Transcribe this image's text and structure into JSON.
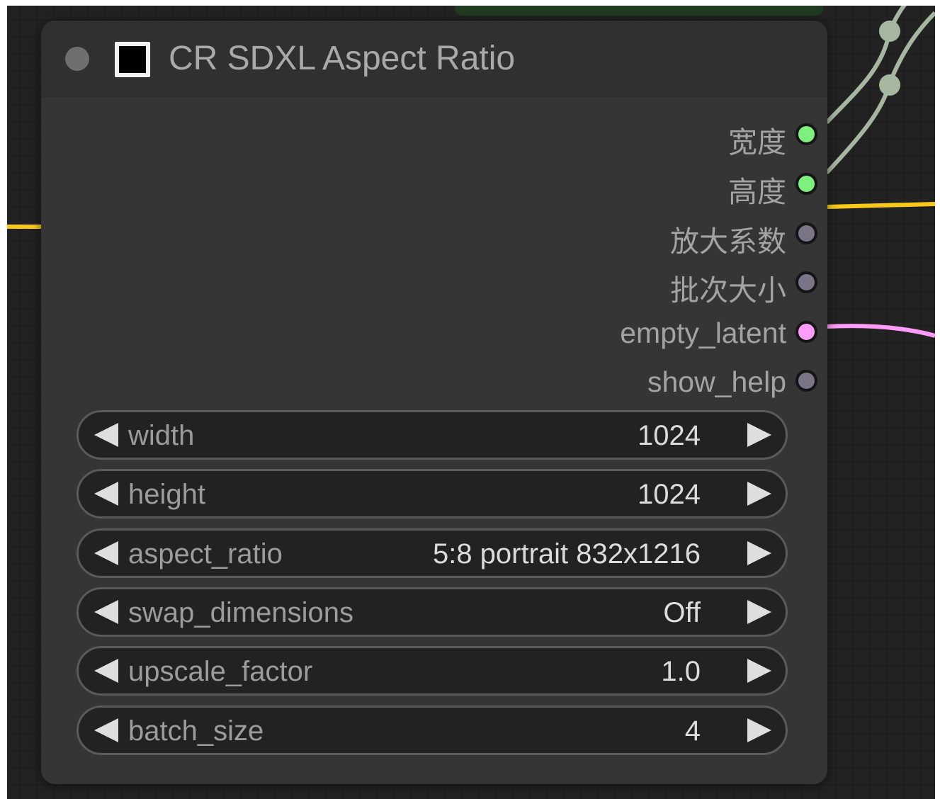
{
  "node": {
    "title": "CR SDXL Aspect Ratio"
  },
  "outputs": [
    {
      "label": "宽度",
      "color": "#7df07d",
      "connected": true
    },
    {
      "label": "高度",
      "color": "#7df07d",
      "connected": true
    },
    {
      "label": "放大系数",
      "color": "#7a7486",
      "connected": false
    },
    {
      "label": "批次大小",
      "color": "#7a7486",
      "connected": false
    },
    {
      "label": "empty_latent",
      "color": "#ff9cf9",
      "connected": true
    },
    {
      "label": "show_help",
      "color": "#7a7486",
      "connected": false
    }
  ],
  "widgets": [
    {
      "name": "width",
      "value": "1024"
    },
    {
      "name": "height",
      "value": "1024"
    },
    {
      "name": "aspect_ratio",
      "value": "5:8 portrait 832x1216"
    },
    {
      "name": "swap_dimensions",
      "value": "Off"
    },
    {
      "name": "upscale_factor",
      "value": "1.0"
    },
    {
      "name": "batch_size",
      "value": "4"
    }
  ],
  "colors": {
    "canvas": "#222222",
    "node_body": "#353535",
    "int_link": "#a6b7a0",
    "latent_link": "#ff9cf9",
    "input_link": "#f8c91b"
  }
}
